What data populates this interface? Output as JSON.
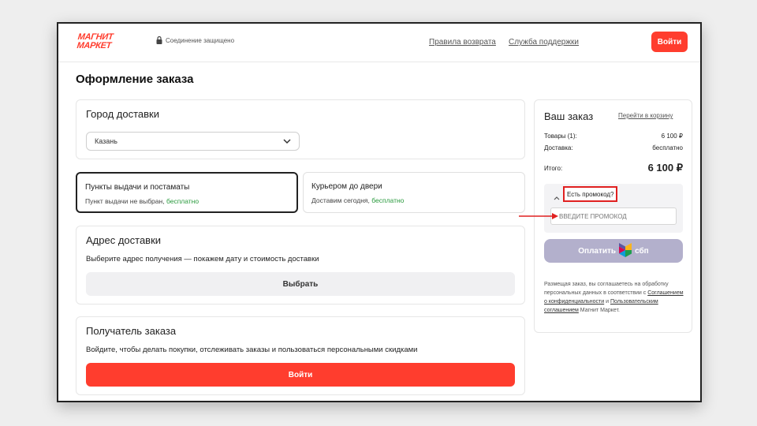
{
  "header": {
    "logo_line1": "МАГНИТ",
    "logo_line2": "МАРКЕТ",
    "secure_text": "Соединение защищено",
    "return_policy_link": "Правила возврата",
    "support_link": "Служба поддержки",
    "login_button": "Войти"
  },
  "page_title": "Оформление заказа",
  "city": {
    "title": "Город доставки",
    "selected": "Казань"
  },
  "delivery_options": [
    {
      "title": "Пункты выдачи и постаматы",
      "subtitle": "Пункт выдачи не выбран, ",
      "price": "бесплатно"
    },
    {
      "title": "Курьером до двери",
      "subtitle": "Доставим сегодня, ",
      "price": "бесплатно"
    }
  ],
  "address": {
    "title": "Адрес доставки",
    "description": "Выберите адрес получения — покажем дату и стоимость доставки",
    "button": "Выбрать"
  },
  "recipient": {
    "title": "Получатель заказа",
    "description": "Войдите, чтобы делать покупки, отслеживать заказы и пользоваться персональными скидками",
    "button": "Войти"
  },
  "order": {
    "title": "Ваш заказ",
    "cart_link": "Перейти в корзину",
    "goods_label": "Товары (1):",
    "goods_value": "6 100 ₽",
    "delivery_label": "Доставка:",
    "delivery_value": "бесплатно",
    "total_label": "Итого:",
    "total_value": "6 100 ₽",
    "promo_toggle": "Есть промокод?",
    "promo_placeholder": "ВВЕДИТЕ ПРОМОКОД",
    "pay_label": "Оплатить",
    "sbp_label": "сбп",
    "legal_1": "Размещая заказ, вы соглашаетесь на обработку персональных данных в соответствии с ",
    "legal_link1": "Соглашением о конфиденциальности",
    "legal_2": " и ",
    "legal_link2": "Пользовательским соглашением",
    "legal_3": " Магнит Маркет."
  },
  "colors": {
    "brand_red": "#ff3d2e",
    "sbp_button": "#b3b0cc",
    "free_green": "#2a9a3e",
    "annotation_red": "#e02020"
  }
}
